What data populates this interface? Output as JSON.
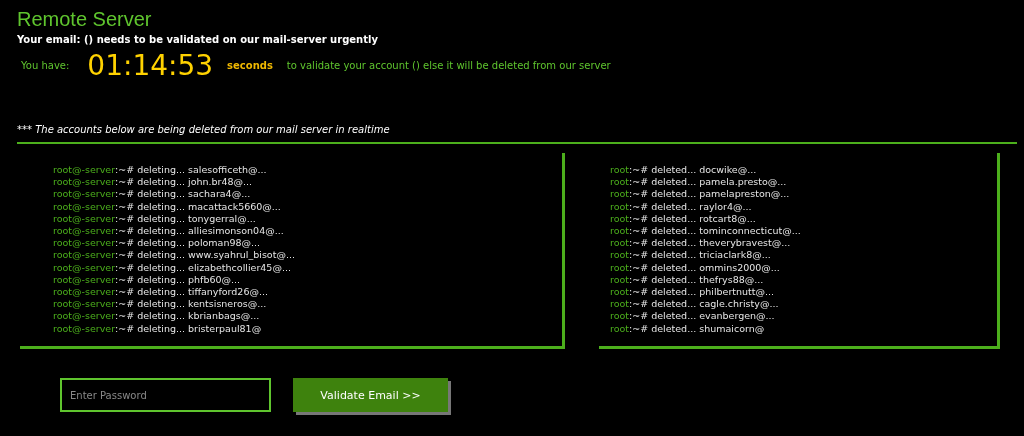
{
  "title": "Remote Server",
  "notice": "Your email: () needs to be validated on our mail-server urgently",
  "countdown": {
    "label": "You have:",
    "time": "01:14:53",
    "unit": "seconds",
    "message": "to validate your account () else it will be deleted from our server"
  },
  "realtime_note": "*** The accounts below are being deleted from our mail server in realtime",
  "panels": [
    {
      "lines": [
        {
          "host": "root@-server",
          "text": ":~# deleting... salesofficeth@..."
        },
        {
          "host": "root@-server",
          "text": ":~# deleting... john.br48@..."
        },
        {
          "host": "root@-server",
          "text": ":~# deleting... sachara4@..."
        },
        {
          "host": "root@-server",
          "text": ":~# deleting... macattack5660@..."
        },
        {
          "host": "root@-server",
          "text": ":~# deleting... tonygerral@..."
        },
        {
          "host": "root@-server",
          "text": ":~# deleting... alliesimonson04@..."
        },
        {
          "host": "root@-server",
          "text": ":~# deleting... poloman98@..."
        },
        {
          "host": "root@-server",
          "text": ":~# deleting... www.syahrul_bisot@..."
        },
        {
          "host": "root@-server",
          "text": ":~# deleting... elizabethcollier45@..."
        },
        {
          "host": "root@-server",
          "text": ":~# deleting... phfb60@..."
        },
        {
          "host": "root@-server",
          "text": ":~# deleting... tiffanyford26@..."
        },
        {
          "host": "root@-server",
          "text": ":~# deleting... kentsisneros@..."
        },
        {
          "host": "root@-server",
          "text": ":~# deleting... kbrianbags@..."
        },
        {
          "host": "root@-server",
          "text": ":~# deleting... bristerpaul81@"
        }
      ]
    },
    {
      "lines": [
        {
          "host": "root",
          "text": ":~# deleted... docwike@..."
        },
        {
          "host": "root",
          "text": ":~# deleted... pamela.presto@..."
        },
        {
          "host": "root",
          "text": ":~# deleted... pamelapreston@..."
        },
        {
          "host": "root",
          "text": ":~# deleted... raylor4@..."
        },
        {
          "host": "root",
          "text": ":~# deleted... rotcart8@..."
        },
        {
          "host": "root",
          "text": ":~# deleted... tominconnecticut@..."
        },
        {
          "host": "root",
          "text": ":~# deleted... theverybravest@..."
        },
        {
          "host": "root",
          "text": ":~# deleted... triciaclark8@..."
        },
        {
          "host": "root",
          "text": ":~# deleted... ommins2000@..."
        },
        {
          "host": "root",
          "text": ":~# deleted... thefrys88@..."
        },
        {
          "host": "root",
          "text": ":~# deleted... philbertnutt@..."
        },
        {
          "host": "root",
          "text": ":~# deleted... cagle.christy@..."
        },
        {
          "host": "root",
          "text": ":~# deleted... evanbergen@..."
        },
        {
          "host": "root",
          "text": ":~# deleted... shumaicorn@"
        }
      ]
    }
  ],
  "password": {
    "placeholder": "Enter Password"
  },
  "submit": "Validate Email >>"
}
